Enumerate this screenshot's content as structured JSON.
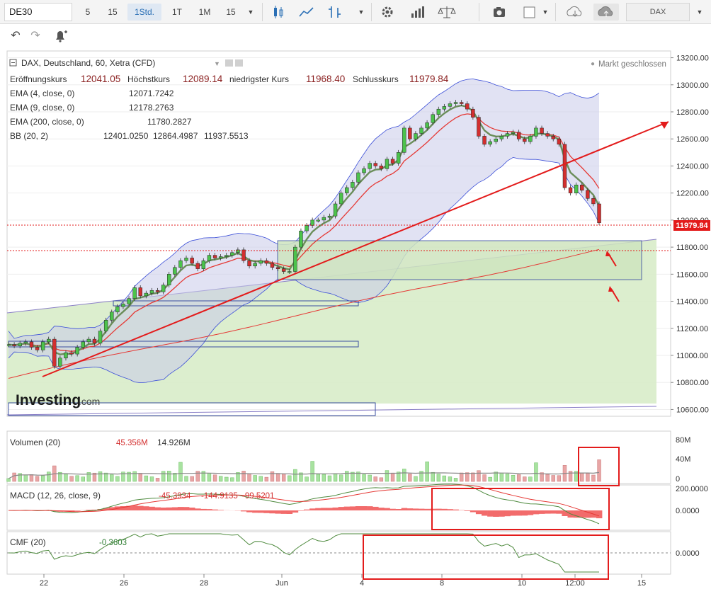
{
  "toolbar": {
    "symbol": "DE30",
    "intervals": [
      "5",
      "15",
      "1Std.",
      "1T",
      "1M",
      "15"
    ],
    "active_interval": "1Std.",
    "exchange": "DAX"
  },
  "header": {
    "title": "DAX, Deutschland, 60, Xetra (CFD)",
    "market_status": "Markt geschlossen",
    "ohlc": [
      {
        "label": "Eröffnungskurs",
        "value": "12041.05"
      },
      {
        "label": "Höchstkurs",
        "value": "12089.14"
      },
      {
        "label": "niedrigster Kurs",
        "value": "11968.40"
      },
      {
        "label": "Schlusskurs",
        "value": "11979.84"
      }
    ]
  },
  "indicators": [
    {
      "name": "EMA (4, close, 0)",
      "values": [
        "12071.7242"
      ],
      "colors": [
        "#2e7d32"
      ]
    },
    {
      "name": "EMA (9, close, 0)",
      "values": [
        "12178.2763"
      ],
      "colors": [
        "#d32f2f"
      ]
    },
    {
      "name": "EMA (200, close, 0)",
      "values": [
        "11780.2827"
      ],
      "colors": [
        "#d32f2f"
      ]
    },
    {
      "name": "BB (20, 2)",
      "values": [
        "12401.0250",
        "12864.4987",
        "11937.5513"
      ],
      "colors": [
        "#d32f2f",
        "#1a3fd0",
        "#1a3fd0"
      ]
    }
  ],
  "watermark": {
    "brand": "Investing",
    "suffix": ".com"
  },
  "price_axis": {
    "ticks": [
      "13200.00",
      "13000.00",
      "12800.00",
      "12600.00",
      "12400.00",
      "12200.00",
      "12000.00",
      "11800.00",
      "11600.00",
      "11400.00",
      "11200.00",
      "11000.00",
      "10800.00",
      "10600.00"
    ],
    "last_price": "11979.84"
  },
  "time_axis": {
    "ticks": [
      "22",
      "26",
      "28",
      "Jun",
      "4",
      "8",
      "10",
      "12:00",
      "15"
    ]
  },
  "panels": {
    "volume": {
      "name": "Volumen (20)",
      "values": [
        "45.356M",
        "14.926M"
      ],
      "ticks": [
        "80M",
        "40M",
        "0"
      ]
    },
    "macd": {
      "name": "MACD (12, 26, close, 9)",
      "values": [
        "-45.3934",
        "-144.9135",
        "-99.5201"
      ],
      "ticks": [
        "200.0000",
        "0.0000"
      ]
    },
    "cmf": {
      "name": "CMF (20)",
      "values": [
        "-0.3603"
      ],
      "ticks": [
        "0.0000"
      ]
    }
  },
  "chart_data": {
    "type": "candlestick",
    "title": "DAX, Deutschland, 60, Xetra (CFD)",
    "ylim": [
      10550,
      13250
    ],
    "x_ticks": [
      "22",
      "26",
      "28",
      "Jun",
      "4",
      "8",
      "10",
      "12:00",
      "15"
    ],
    "closes": [
      11080,
      11070,
      11090,
      11100,
      11060,
      11040,
      11100,
      11120,
      10920,
      10980,
      11020,
      11010,
      11060,
      11100,
      11120,
      11090,
      11180,
      11260,
      11320,
      11360,
      11380,
      11420,
      11500,
      11440,
      11460,
      11480,
      11470,
      11520,
      11600,
      11650,
      11700,
      11720,
      11680,
      11640,
      11700,
      11740,
      11720,
      11730,
      11740,
      11760,
      11780,
      11700,
      11660,
      11680,
      11700,
      11680,
      11650,
      11640,
      11620,
      11620,
      11800,
      11920,
      11960,
      12000,
      12000,
      12020,
      12030,
      12120,
      12200,
      12240,
      12280,
      12350,
      12380,
      12420,
      12400,
      12380,
      12450,
      12420,
      12500,
      12680,
      12600,
      12640,
      12680,
      12720,
      12780,
      12820,
      12840,
      12860,
      12870,
      12860,
      12820,
      12760,
      12620,
      12560,
      12580,
      12600,
      12620,
      12640,
      12650,
      12600,
      12580,
      12620,
      12680,
      12640,
      12620,
      12600,
      12560,
      12240,
      12200,
      12260,
      12220,
      12160,
      12120,
      11980
    ],
    "ema4_last": 12071.7242,
    "ema9_last": 12178.2763,
    "ema200_last": 11780.2827,
    "bb": {
      "middle": 12401.025,
      "upper": 12864.4987,
      "lower": 11937.5513
    },
    "last_price": 11979.84
  }
}
